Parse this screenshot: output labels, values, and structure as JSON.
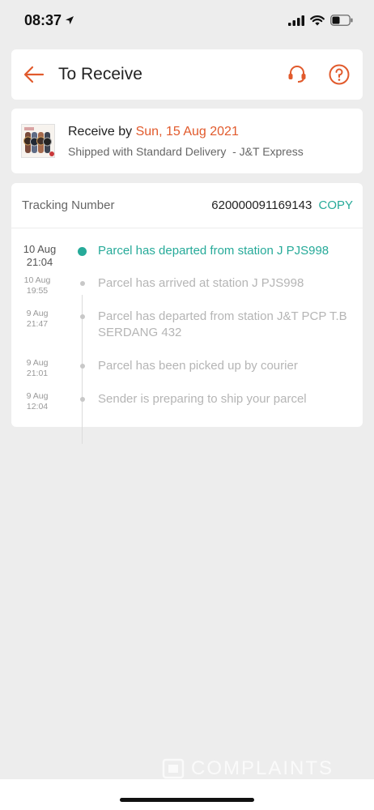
{
  "status_bar": {
    "time": "08:37"
  },
  "header": {
    "title": "To Receive",
    "back_icon": "arrow-left-icon",
    "support_icon": "headset-icon",
    "help_icon": "question-circle-icon"
  },
  "delivery": {
    "receive_prefix": "Receive by",
    "receive_date": "Sun, 15 Aug 2021",
    "shipped_text": "Shipped with Standard Delivery  - J&T Express"
  },
  "tracking": {
    "label": "Tracking Number",
    "number": "620000091169143",
    "copy_label": "COPY",
    "events": [
      {
        "date": "10 Aug",
        "time": "21:04",
        "text": "Parcel has departed from station J PJS998"
      },
      {
        "date": "10 Aug",
        "time": "19:55",
        "text": "Parcel has arrived at station J PJS998"
      },
      {
        "date": "9 Aug",
        "time": "21:47",
        "text": "Parcel has departed from station J&T PCP T.B SERDANG 432"
      },
      {
        "date": "9 Aug",
        "time": "21:01",
        "text": "Parcel has been picked up by courier"
      },
      {
        "date": "9 Aug",
        "time": "12:04",
        "text": "Sender is preparing to ship your parcel"
      }
    ]
  },
  "watermark": {
    "text": "COMPLAINTS"
  },
  "colors": {
    "accent_orange": "#e15a2c",
    "accent_green": "#26aa99",
    "background": "#ededed"
  }
}
